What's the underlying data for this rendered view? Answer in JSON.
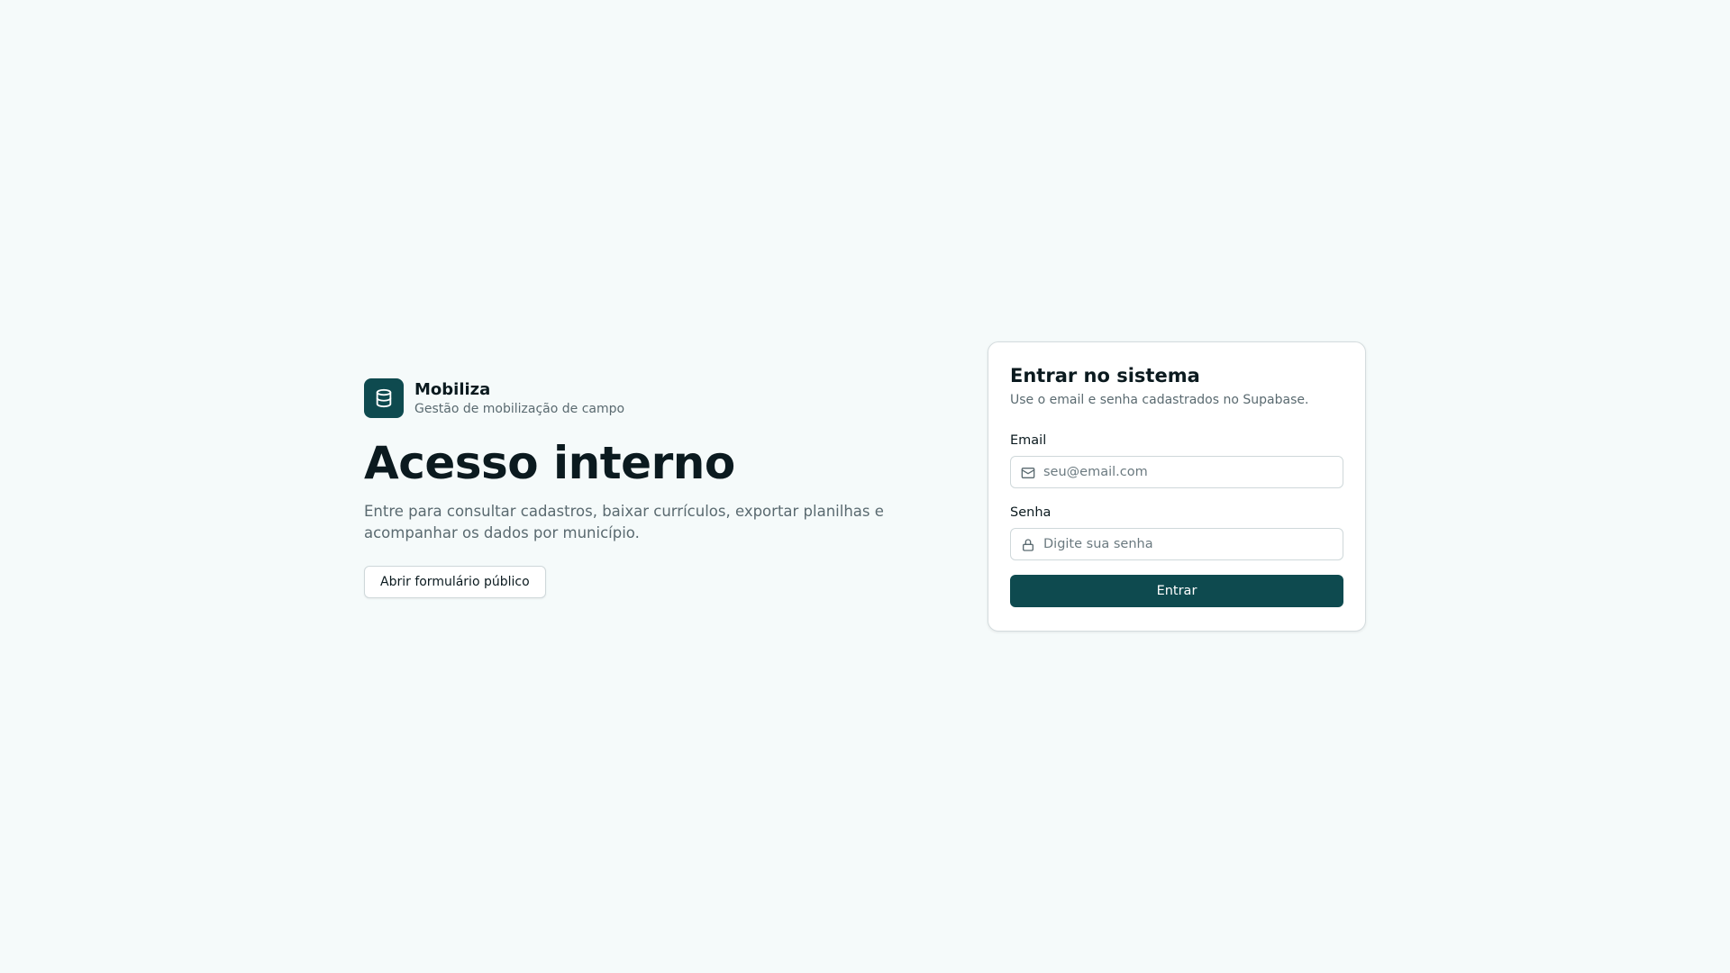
{
  "brand": {
    "name": "Mobiliza",
    "tagline": "Gestão de mobilização de campo",
    "logo_icon": "database-icon"
  },
  "hero": {
    "title": "Acesso interno",
    "description": "Entre para consultar cadastros, baixar currículos, exportar planilhas e acompanhar os dados por município.",
    "public_form_button": "Abrir formulário público"
  },
  "login": {
    "title": "Entrar no sistema",
    "subtitle": "Use o email e senha cadastrados no Supabase.",
    "email": {
      "label": "Email",
      "placeholder": "seu@email.com",
      "value": "",
      "icon": "mail-icon"
    },
    "password": {
      "label": "Senha",
      "placeholder": "Digite sua senha",
      "value": "",
      "icon": "lock-icon"
    },
    "submit_label": "Entrar"
  },
  "colors": {
    "background": "#f5fafa",
    "accent": "#0e4a4f",
    "text": "#0b1a1f",
    "muted": "#5a6a70"
  }
}
